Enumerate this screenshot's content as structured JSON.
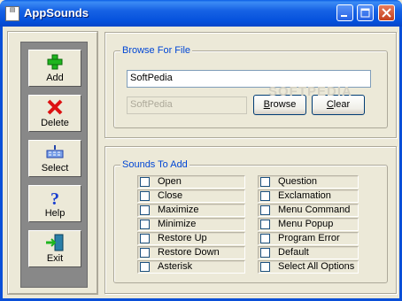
{
  "window": {
    "title": "AppSounds"
  },
  "nav": [
    {
      "name": "add-button",
      "label": "Add",
      "icon": "plus-icon"
    },
    {
      "name": "delete-button",
      "label": "Delete",
      "icon": "red-x-icon"
    },
    {
      "name": "select-button",
      "label": "Select",
      "icon": "select-icon"
    },
    {
      "name": "help-button",
      "label": "Help",
      "icon": "question-icon"
    },
    {
      "name": "exit-button",
      "label": "Exit",
      "icon": "exit-door-icon"
    }
  ],
  "browse": {
    "legend": "Browse For File",
    "path_value": "SoftPedia",
    "second_value": "SoftPedia",
    "browse_label": "Browse",
    "clear_label": "Clear"
  },
  "sounds": {
    "legend": "Sounds To Add",
    "left": [
      "Open",
      "Close",
      "Maximize",
      "Minimize",
      "Restore Up",
      "Restore Down",
      "Asterisk"
    ],
    "right": [
      "Question",
      "Exclamation",
      "Menu Command",
      "Menu Popup",
      "Program Error",
      "Default",
      "Select All Options"
    ]
  },
  "watermark": "SOFTPEDIA"
}
